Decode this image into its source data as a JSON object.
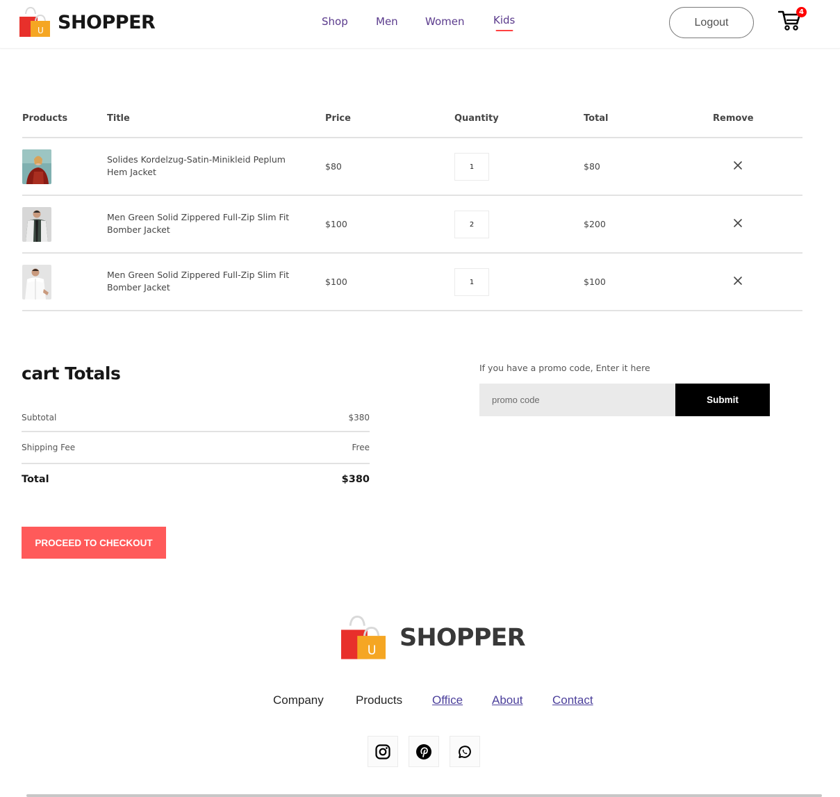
{
  "navbar": {
    "brand": "SHOPPER",
    "menu": [
      {
        "label": "Shop"
      },
      {
        "label": "Men"
      },
      {
        "label": "Women"
      },
      {
        "label": "Kids"
      }
    ],
    "active_menu": "Kids",
    "logout_label": "Logout",
    "cart_count": "4",
    "icons": {
      "logo": "shopping-bag-logo",
      "cart": "cart-icon"
    }
  },
  "cart": {
    "headers": {
      "products": "Products",
      "title": "Title",
      "price": "Price",
      "quantity": "Quantity",
      "total": "Total",
      "remove": "Remove"
    },
    "items": [
      {
        "title": "Solides Kordelzug-Satin-Minikleid Peplum Hem Jacket",
        "price": "$80",
        "quantity": "1",
        "total": "$80",
        "thumb": "woman-red-top-photo"
      },
      {
        "title": "Men Green Solid Zippered Full-Zip Slim Fit Bomber Jacket",
        "price": "$100",
        "quantity": "2",
        "total": "$200",
        "thumb": "man-bomber-jacket-photo"
      },
      {
        "title": "Men Green Solid Zippered Full-Zip Slim Fit Bomber Jacket",
        "price": "$100",
        "quantity": "1",
        "total": "$100",
        "thumb": "man-white-shirt-photo"
      }
    ]
  },
  "totals": {
    "heading": "cart Totals",
    "subtotal_label": "Subtotal",
    "subtotal_value": "$380",
    "shipping_label": "Shipping Fee",
    "shipping_value": "Free",
    "total_label": "Total",
    "total_value": "$380",
    "checkout_label": "PROCEED TO CHECKOUT"
  },
  "promo": {
    "prompt": "If you have a promo code, Enter it here",
    "placeholder": "promo code",
    "submit_label": "Submit"
  },
  "footer": {
    "brand": "SHOPPER",
    "links": [
      {
        "label": "Company"
      },
      {
        "label": "Products"
      },
      {
        "label": "Office"
      },
      {
        "label": "About"
      },
      {
        "label": "Contact"
      }
    ],
    "social_icons": [
      "instagram-icon",
      "pinterest-icon",
      "whatsapp-icon"
    ]
  },
  "colors": {
    "accent": "#ff4141",
    "checkout": "#ff5a5a",
    "menu_text": "#5a3a8c",
    "submit": "#000000",
    "badge": "#ff0000"
  }
}
